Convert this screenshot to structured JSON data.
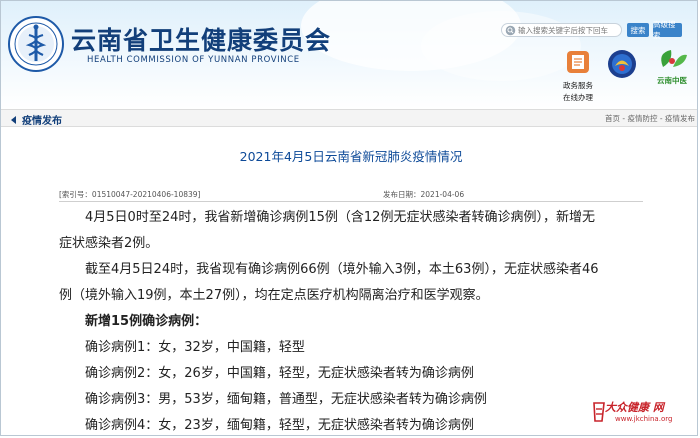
{
  "header": {
    "site_title": "云南省卫生健康委员会",
    "site_subtitle": "HEALTH COMMISSION OF YUNNAN PROVINCE",
    "search_placeholder": "输入搜索关键字后按下回车",
    "search_button": "搜索",
    "advanced_search_button": "高级搜索",
    "service_label_1": "政务服务",
    "service_label_2": "在线办理",
    "badge2_text": "云南中医",
    "brand_color": "#123f7a",
    "button_color": "#3a83c9"
  },
  "nav": {
    "current_section": "疫情发布",
    "breadcrumb": "首页 - 疫情防控 - 疫情发布"
  },
  "article": {
    "title": "2021年4月5日云南省新冠肺炎疫情情况",
    "index_no": "[索引号：01510047-20210406-10839]",
    "publish_date": "发布日期：2021-04-06",
    "para1_line1": "4月5日0时至24时，我省新增确诊病例15例（含12例无症状感染者转确诊病例），新增无",
    "para1_line2": "症状感染者2例。",
    "para2_line1": "截至4月5日24时，我省现有确诊病例66例（境外输入3例，本土63例），无症状感染者46",
    "para2_line2": "例（境外输入19例，本土27例），均在定点医疗机构隔离治疗和医学观察。",
    "subheading": "新增15例确诊病例：",
    "cases": [
      "确诊病例1：女，32岁，中国籍，轻型",
      "确诊病例2：女，26岁，中国籍，轻型，无症状感染者转为确诊病例",
      "确诊病例3：男，53岁，缅甸籍，普通型，无症状感染者转为确诊病例",
      "确诊病例4：女，23岁，缅甸籍，轻型，无症状感染者转为确诊病例"
    ],
    "title_color": "#0d4a98"
  },
  "watermark": {
    "text": "大众健康 网",
    "url": "www.jkchina.org"
  }
}
